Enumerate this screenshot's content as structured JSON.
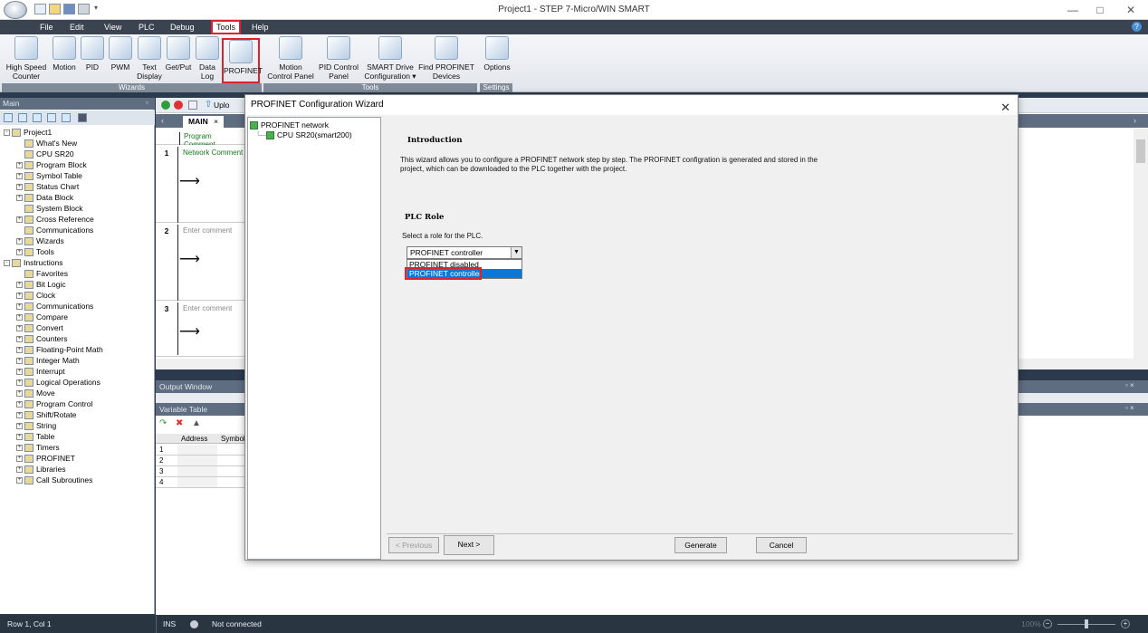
{
  "window": {
    "title": "Project1 - STEP 7-Micro/WIN SMART"
  },
  "menu": [
    "File",
    "Edit",
    "View",
    "PLC",
    "Debug",
    "Tools",
    "Help"
  ],
  "ribbon": {
    "wizards_label": "Wizards",
    "tools_label": "Tools",
    "settings_label": "Settings",
    "buttons": [
      {
        "label": "High Speed\nCounter"
      },
      {
        "label": "Motion"
      },
      {
        "label": "PID"
      },
      {
        "label": "PWM"
      },
      {
        "label": "Text\nDisplay"
      },
      {
        "label": "Get/Put"
      },
      {
        "label": "Data\nLog"
      },
      {
        "label": "PROFINET"
      },
      {
        "label": "Motion\nControl Panel"
      },
      {
        "label": "PID Control\nPanel"
      },
      {
        "label": "SMART Drive\nConfiguration ▾"
      },
      {
        "label": "Find PROFINET\nDevices"
      },
      {
        "label": "Options"
      }
    ]
  },
  "left_panel": {
    "header": "Main",
    "tree": [
      {
        "label": "Project1",
        "level": 0,
        "exp": "-"
      },
      {
        "label": "What's New",
        "level": 1,
        "exp": ""
      },
      {
        "label": "CPU SR20",
        "level": 1,
        "exp": ""
      },
      {
        "label": "Program Block",
        "level": 1,
        "exp": "+"
      },
      {
        "label": "Symbol Table",
        "level": 1,
        "exp": "+"
      },
      {
        "label": "Status Chart",
        "level": 1,
        "exp": "+"
      },
      {
        "label": "Data Block",
        "level": 1,
        "exp": "+"
      },
      {
        "label": "System Block",
        "level": 1,
        "exp": ""
      },
      {
        "label": "Cross Reference",
        "level": 1,
        "exp": "+"
      },
      {
        "label": "Communications",
        "level": 1,
        "exp": ""
      },
      {
        "label": "Wizards",
        "level": 1,
        "exp": "+"
      },
      {
        "label": "Tools",
        "level": 1,
        "exp": "+"
      },
      {
        "label": "Instructions",
        "level": 0,
        "exp": "-"
      },
      {
        "label": "Favorites",
        "level": 1,
        "exp": ""
      },
      {
        "label": "Bit Logic",
        "level": 1,
        "exp": "+"
      },
      {
        "label": "Clock",
        "level": 1,
        "exp": "+"
      },
      {
        "label": "Communications",
        "level": 1,
        "exp": "+"
      },
      {
        "label": "Compare",
        "level": 1,
        "exp": "+"
      },
      {
        "label": "Convert",
        "level": 1,
        "exp": "+"
      },
      {
        "label": "Counters",
        "level": 1,
        "exp": "+"
      },
      {
        "label": "Floating-Point Math",
        "level": 1,
        "exp": "+"
      },
      {
        "label": "Integer Math",
        "level": 1,
        "exp": "+"
      },
      {
        "label": "Interrupt",
        "level": 1,
        "exp": "+"
      },
      {
        "label": "Logical Operations",
        "level": 1,
        "exp": "+"
      },
      {
        "label": "Move",
        "level": 1,
        "exp": "+"
      },
      {
        "label": "Program Control",
        "level": 1,
        "exp": "+"
      },
      {
        "label": "Shift/Rotate",
        "level": 1,
        "exp": "+"
      },
      {
        "label": "String",
        "level": 1,
        "exp": "+"
      },
      {
        "label": "Table",
        "level": 1,
        "exp": "+"
      },
      {
        "label": "Timers",
        "level": 1,
        "exp": "+"
      },
      {
        "label": "PROFINET",
        "level": 1,
        "exp": "+"
      },
      {
        "label": "Libraries",
        "level": 1,
        "exp": "+"
      },
      {
        "label": "Call Subroutines",
        "level": 1,
        "exp": "+"
      }
    ]
  },
  "editor": {
    "toolbar_upload": "Uplo",
    "tab_main": "MAIN",
    "program_comment": "Program Comment",
    "networks": [
      {
        "num": "1",
        "comment": "Network Comment"
      },
      {
        "num": "2",
        "comment": "Enter comment"
      },
      {
        "num": "3",
        "comment": "Enter comment"
      }
    ]
  },
  "output_window": "Output Window",
  "variable_table": {
    "title": "Variable Table",
    "col_address": "Address",
    "col_symbol": "Symbol",
    "rows": [
      "1",
      "2",
      "3",
      "4"
    ]
  },
  "status": {
    "position": "Row 1, Col 1",
    "mode": "INS",
    "connection": "Not connected",
    "zoom": "100%"
  },
  "dialog": {
    "title": "PROFINET Configuration Wizard",
    "tree_root": "PROFINET network",
    "tree_child": "CPU SR20(smart200)",
    "intro_heading": "Introduction",
    "intro_text": "This wizard allows you to configure a PROFINET network step by step. The PROFINET configration is generated and stored in the project, which can be downloaded to the PLC together with the project.",
    "role_heading": "PLC Role",
    "role_prompt": "Select a role for the PLC.",
    "role_selected": "PROFINET controller",
    "role_options": [
      "PROFINET disabled",
      "PROFINET controller"
    ],
    "btn_previous": "< Previous",
    "btn_next": "Next >",
    "btn_generate": "Generate",
    "btn_cancel": "Cancel"
  },
  "colors": {
    "highlight": "#d9262e",
    "selection": "#0a78d7",
    "panel_header": "#5e6d80"
  }
}
